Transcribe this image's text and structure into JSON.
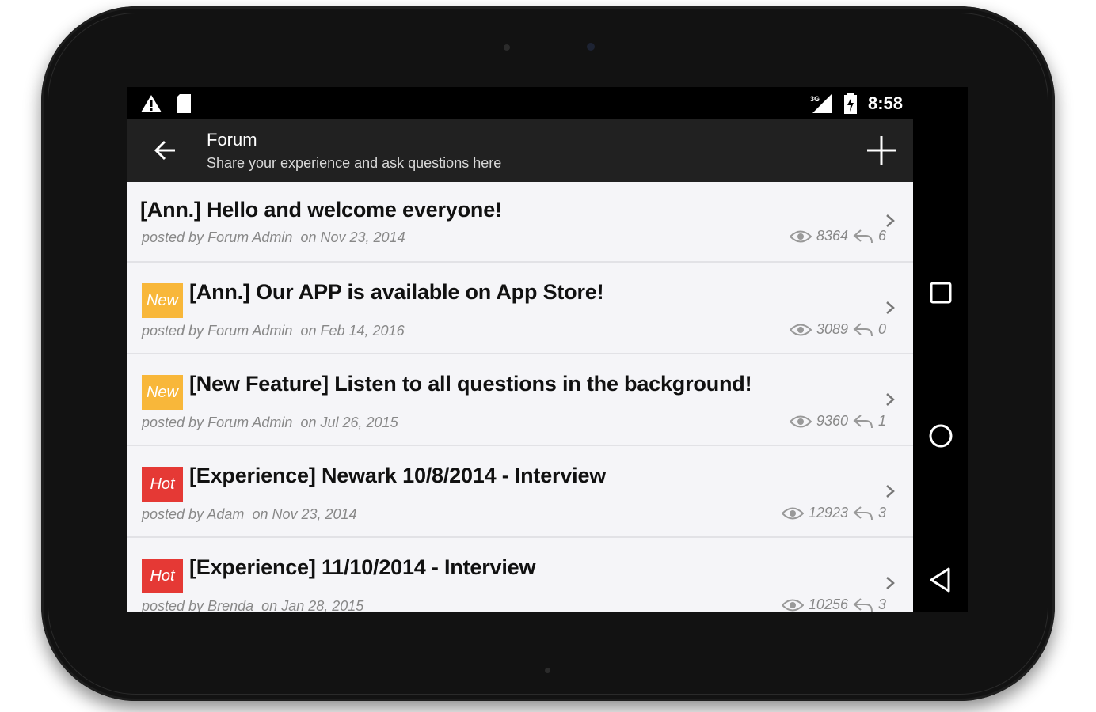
{
  "statusbar": {
    "time": "8:58",
    "icons": [
      "warning-icon",
      "sd-card-icon",
      "signal-3g-icon",
      "battery-charging-icon"
    ]
  },
  "appbar": {
    "title": "Forum",
    "subtitle": "Share your experience and ask questions here"
  },
  "navbar": {
    "icons": [
      "recent-apps-icon",
      "home-icon",
      "back-nav-icon"
    ]
  },
  "colors": {
    "new_badge": "#f8b73a",
    "hot_badge": "#e53935",
    "appbar": "#212121",
    "list_bg": "#f5f5f8"
  },
  "threads": [
    {
      "badge": "",
      "title": "[Ann.] Hello and welcome everyone!",
      "posted_by_label": "posted by",
      "author": "Forum Admin",
      "on_label": "on",
      "date": "Nov 23, 2014",
      "views": "8364",
      "replies": "6"
    },
    {
      "badge": "New",
      "title": "[Ann.] Our APP is available on App Store!",
      "posted_by_label": "posted by",
      "author": "Forum Admin",
      "on_label": "on",
      "date": "Feb 14, 2016",
      "views": "3089",
      "replies": "0"
    },
    {
      "badge": "New",
      "title": "[New Feature] Listen to all questions in the background!",
      "posted_by_label": "posted by",
      "author": "Forum Admin",
      "on_label": "on",
      "date": "Jul 26, 2015",
      "views": "9360",
      "replies": "1"
    },
    {
      "badge": "Hot",
      "title": "[Experience] Newark 10/8/2014 - Interview",
      "posted_by_label": "posted by",
      "author": "Adam",
      "on_label": "on",
      "date": "Nov 23, 2014",
      "views": "12923",
      "replies": "3"
    },
    {
      "badge": "Hot",
      "title": "[Experience] 11/10/2014 - Interview",
      "posted_by_label": "posted by",
      "author": "Brenda",
      "on_label": "on",
      "date": "Jan 28, 2015",
      "views": "10256",
      "replies": "3"
    }
  ]
}
